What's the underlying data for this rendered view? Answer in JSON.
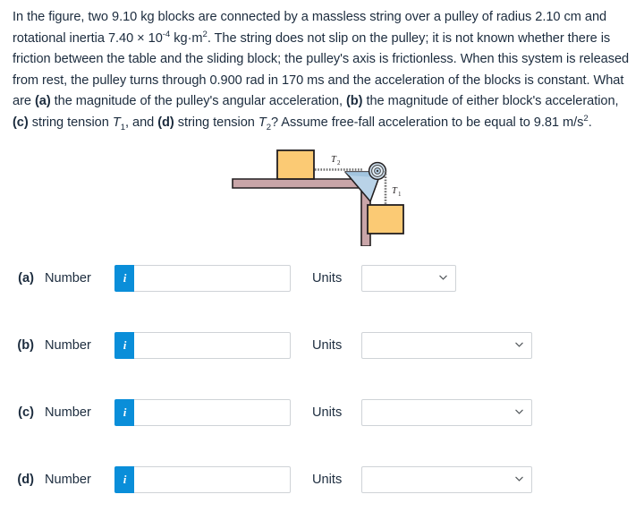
{
  "problem": {
    "line_1_pre": "In the figure, two ",
    "mass": "9.10 kg",
    "line_1_mid": " blocks are connected by a massless string over a pulley of radius ",
    "radius": "2.10 cm",
    "line_2_pre": "and rotational inertia ",
    "inertia_mantissa": "7.40 × 10",
    "inertia_exp": "-4",
    "inertia_unit": " kg·m",
    "inertia_unit_exp": "2",
    "line_2_post": ". The string does not slip on the pulley; it is not known",
    "line_3": "whether there is friction between the table and the sliding block; the pulley's axis is frictionless.",
    "line_4_pre": "When this system is released from rest, the pulley turns through ",
    "angle": "0.900 rad",
    "line_4_mid": " in ",
    "time": "170 ms",
    "line_4_post": " and the",
    "line_5_pre": "acceleration of the blocks is constant. What are ",
    "part_a_tag": "(a)",
    "line_5_mid": " the magnitude of the pulley's angular",
    "line_6_pre": "acceleration, ",
    "part_b_tag": "(b)",
    "line_6_mid": " the magnitude of either block's acceleration, ",
    "part_c_tag": "(c)",
    "line_6_mid2": " string tension ",
    "tension_1_sym": "T",
    "tension_1_sub": "1",
    "line_6_mid3": ", and ",
    "part_d_tag": "(d)",
    "line_6_post": " string",
    "line_7_pre": "tension ",
    "tension_2_sym": "T",
    "tension_2_sub": "2",
    "line_7_mid": "? Assume free-fall acceleration to be equal to ",
    "gravity": "9.81 m/s",
    "gravity_exp": "2",
    "line_7_post": "."
  },
  "figure": {
    "label_t2": "T",
    "label_t2_sub": "2",
    "label_t1": "T",
    "label_t1_sub": "1",
    "colors": {
      "block_fill": "#fbca74",
      "block_stroke": "#231f20",
      "table_fill": "#c9a5a8",
      "table_stroke": "#231f20",
      "bracket_fill": "#b9d3e8",
      "bracket_stroke": "#231f20",
      "pulley_fill": "#cfe0ee",
      "string": "#5a5a5a"
    }
  },
  "answers": {
    "units_label": "Units",
    "number_label": "Number",
    "info_glyph": "i",
    "rows": [
      {
        "id": "a",
        "tag": "(a)",
        "number_value": "",
        "number_placeholder": "",
        "units_value": "",
        "select_width": "narrow"
      },
      {
        "id": "b",
        "tag": "(b)",
        "number_value": "",
        "number_placeholder": "",
        "units_value": "",
        "select_width": "wide"
      },
      {
        "id": "c",
        "tag": "(c)",
        "number_value": "",
        "number_placeholder": "",
        "units_value": "",
        "select_width": "wide"
      },
      {
        "id": "d",
        "tag": "(d)",
        "number_value": "",
        "number_placeholder": "",
        "units_value": "",
        "select_width": "wide"
      }
    ]
  },
  "theme": {
    "accent_blue": "#0a8ed9",
    "text_color": "#1c2c3e",
    "border_grey": "#cfd3d7"
  }
}
